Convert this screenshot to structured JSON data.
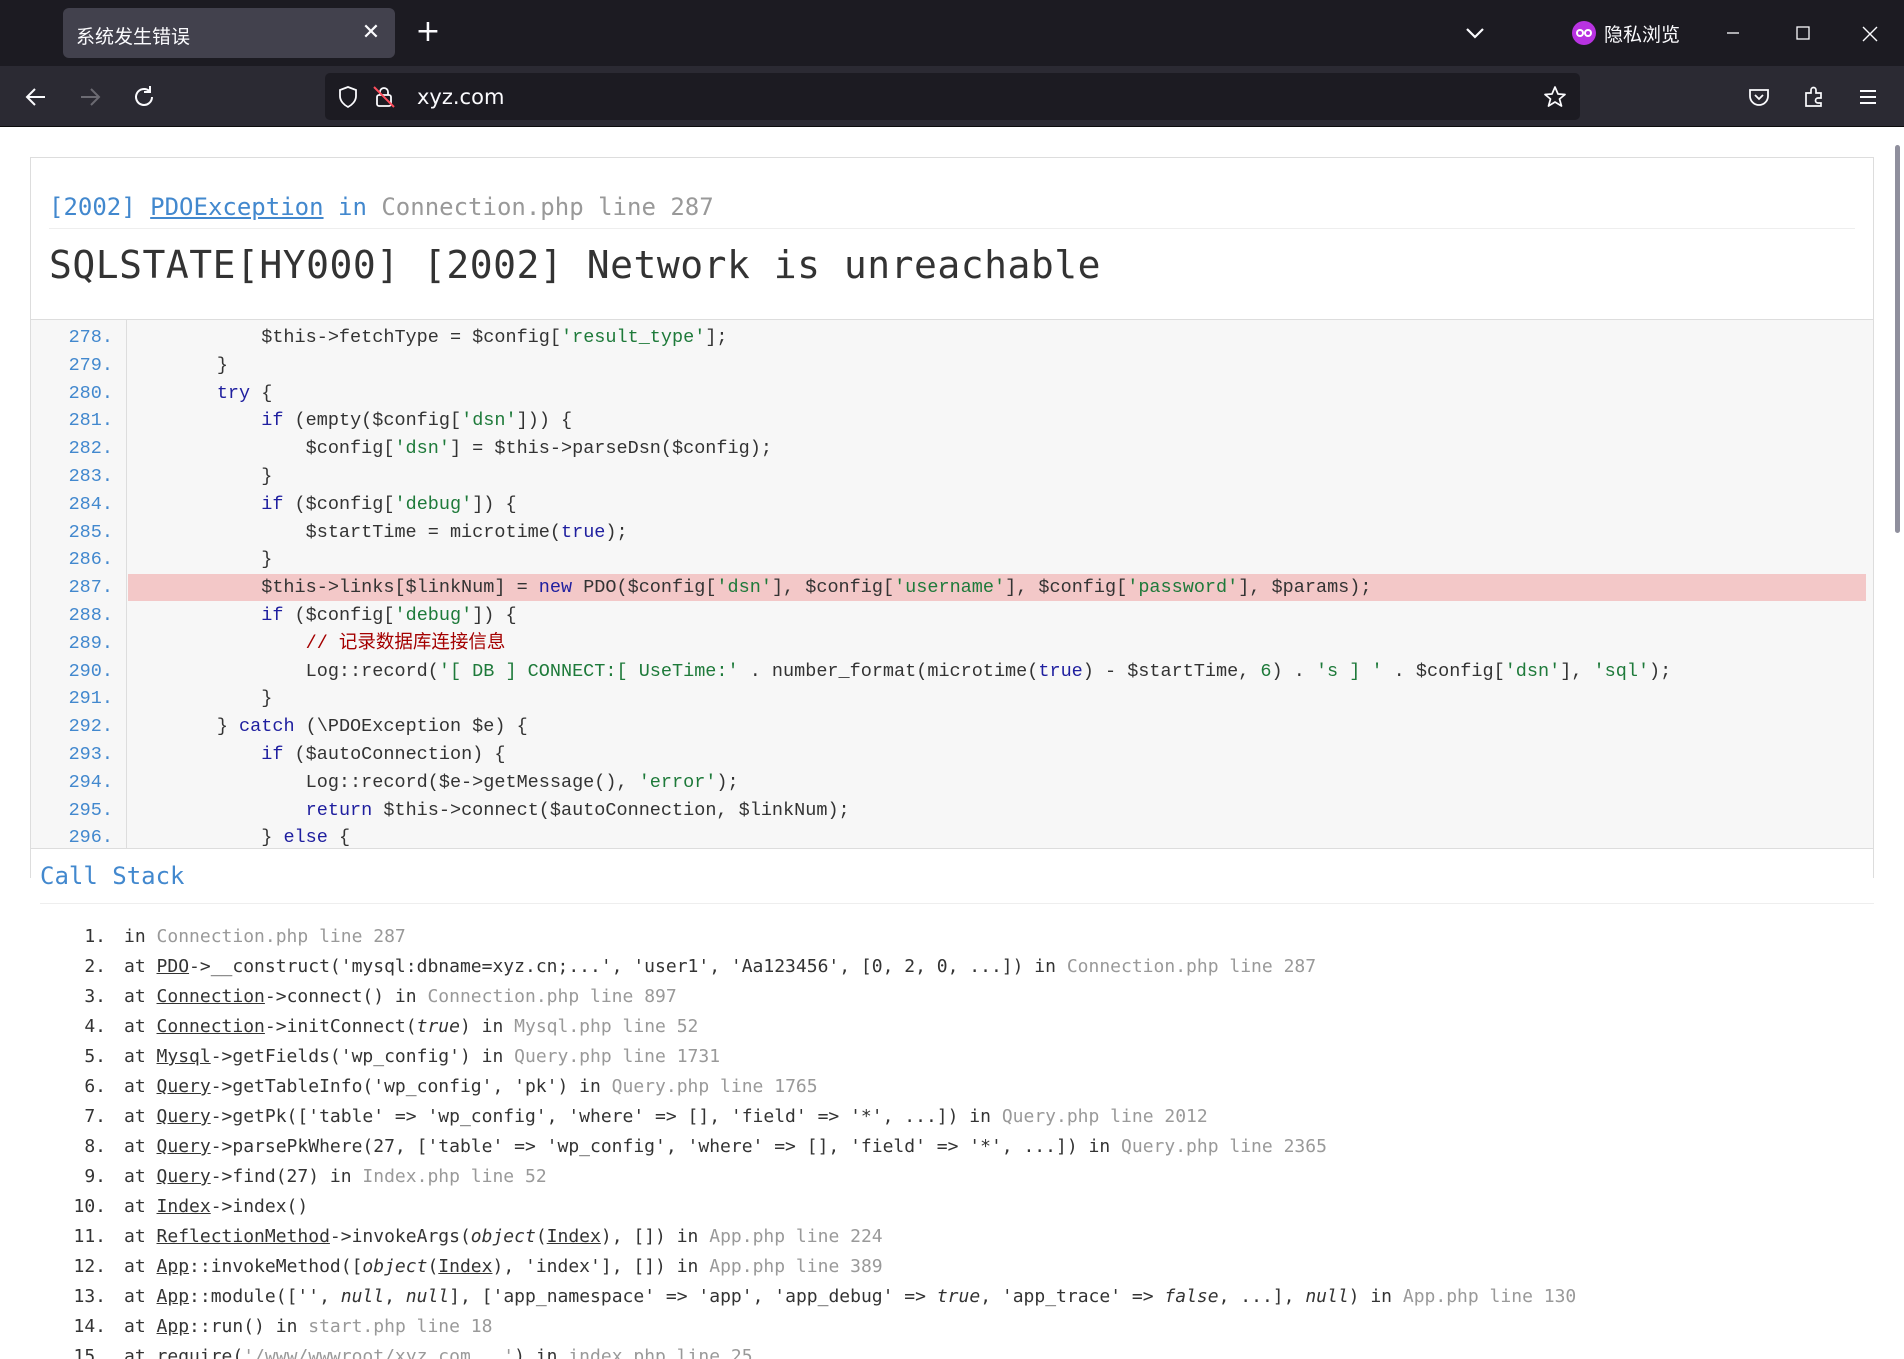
{
  "browser": {
    "tab_title": "系统发生错误",
    "private_label": "隐私浏览",
    "url": "xyz.com"
  },
  "exception": {
    "code": "[2002]",
    "class": "PDOException",
    "in_word": "in",
    "file_line": "Connection.php line 287",
    "message": "SQLSTATE[HY000] [2002] Network is unreachable"
  },
  "source": {
    "lines": [
      {
        "n": "278.",
        "code": "            $this->fetchType = $config['result_type'];"
      },
      {
        "n": "279.",
        "code": "        }"
      },
      {
        "n": "280.",
        "code": "        try {"
      },
      {
        "n": "281.",
        "code": "            if (empty($config['dsn'])) {"
      },
      {
        "n": "282.",
        "code": "                $config['dsn'] = $this->parseDsn($config);"
      },
      {
        "n": "283.",
        "code": "            }"
      },
      {
        "n": "284.",
        "code": "            if ($config['debug']) {"
      },
      {
        "n": "285.",
        "code": "                $startTime = microtime(true);"
      },
      {
        "n": "286.",
        "code": "            }"
      },
      {
        "n": "287.",
        "code": "            $this->links[$linkNum] = new PDO($config['dsn'], $config['username'], $config['password'], $params);"
      },
      {
        "n": "288.",
        "code": "            if ($config['debug']) {"
      },
      {
        "n": "289.",
        "code": "                // 记录数据库连接信息"
      },
      {
        "n": "290.",
        "code": "                Log::record('[ DB ] CONNECT:[ UseTime:' . number_format(microtime(true) - $startTime, 6) . 's ] ' . $config['dsn'], 'sql');"
      },
      {
        "n": "291.",
        "code": "            }"
      },
      {
        "n": "292.",
        "code": "        } catch (\\PDOException $e) {"
      },
      {
        "n": "293.",
        "code": "            if ($autoConnection) {"
      },
      {
        "n": "294.",
        "code": "                Log::record($e->getMessage(), 'error');"
      },
      {
        "n": "295.",
        "code": "                return $this->connect($autoConnection, $linkNum);"
      },
      {
        "n": "296.",
        "code": "            } else {"
      }
    ],
    "highlight_line": "287."
  },
  "call_stack": {
    "title": "Call Stack",
    "items": [
      {
        "n": "1.",
        "text": "in Connection.php line 287"
      },
      {
        "n": "2.",
        "text": "at PDO->__construct('mysql:dbname=xyz.cn;...', 'user1', 'Aa123456', [0, 2, 0, ...]) in Connection.php line 287"
      },
      {
        "n": "3.",
        "text": "at Connection->connect() in Connection.php line 897"
      },
      {
        "n": "4.",
        "text": "at Connection->initConnect(true) in Mysql.php line 52"
      },
      {
        "n": "5.",
        "text": "at Mysql->getFields('wp_config') in Query.php line 1731"
      },
      {
        "n": "6.",
        "text": "at Query->getTableInfo('wp_config', 'pk') in Query.php line 1765"
      },
      {
        "n": "7.",
        "text": "at Query->getPk(['table' => 'wp_config', 'where' => [], 'field' => '*', ...]) in Query.php line 2012"
      },
      {
        "n": "8.",
        "text": "at Query->parsePkWhere(27, ['table' => 'wp_config', 'where' => [], 'field' => '*', ...]) in Query.php line 2365"
      },
      {
        "n": "9.",
        "text": "at Query->find(27) in Index.php line 52"
      },
      {
        "n": "10.",
        "text": "at Index->index()"
      },
      {
        "n": "11.",
        "text": "at ReflectionMethod->invokeArgs(object(Index), []) in App.php line 224"
      },
      {
        "n": "12.",
        "text": "at App::invokeMethod([object(Index), 'index'], []) in App.php line 389"
      },
      {
        "n": "13.",
        "text": "at App::module(['', null, null], ['app_namespace' => 'app', 'app_debug' => true, 'app_trace' => false, ...], null) in App.php line 130"
      },
      {
        "n": "14.",
        "text": "at App::run() in start.php line 18"
      },
      {
        "n": "15.",
        "text": "at require('/www/wwwroot/xyz.com...') in index.php line 25"
      }
    ]
  }
}
